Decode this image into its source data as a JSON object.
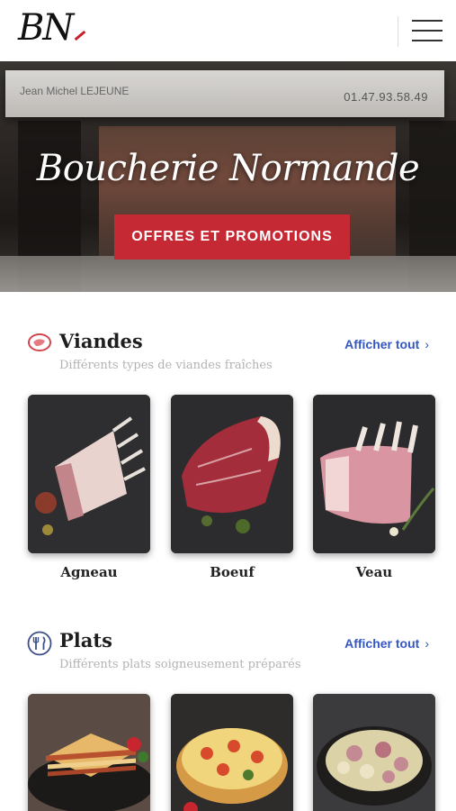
{
  "header": {
    "logo_text": "BN",
    "menu_icon": "hamburger-menu-icon"
  },
  "hero": {
    "awning_name": "Jean Michel LEJEUNE",
    "awning_phone": "01.47.93.58.49",
    "title": "Boucherie Normande",
    "button_label": "OFFRES ET PROMOTIONS",
    "accent_color": "#c52a34"
  },
  "sections": [
    {
      "icon": "steak-icon",
      "title": "Viandes",
      "subtitle": "Différents types de viandes fraîches",
      "link_label": "Afficher tout",
      "link_chevron": "›",
      "items": [
        {
          "label": "Agneau",
          "image": "lamb-rack-image"
        },
        {
          "label": "Boeuf",
          "image": "beef-rib-image"
        },
        {
          "label": "Veau",
          "image": "veal-rack-image"
        }
      ]
    },
    {
      "icon": "cutlery-icon",
      "title": "Plats",
      "subtitle": "Différents plats soigneusement préparés",
      "link_label": "Afficher tout",
      "link_chevron": "›",
      "items": [
        {
          "label": "",
          "image": "lasagna-image"
        },
        {
          "label": "",
          "image": "quiche-image"
        },
        {
          "label": "",
          "image": "potato-salad-image"
        }
      ]
    }
  ],
  "colors": {
    "link": "#3557c2",
    "brand_red": "#c52a34"
  }
}
